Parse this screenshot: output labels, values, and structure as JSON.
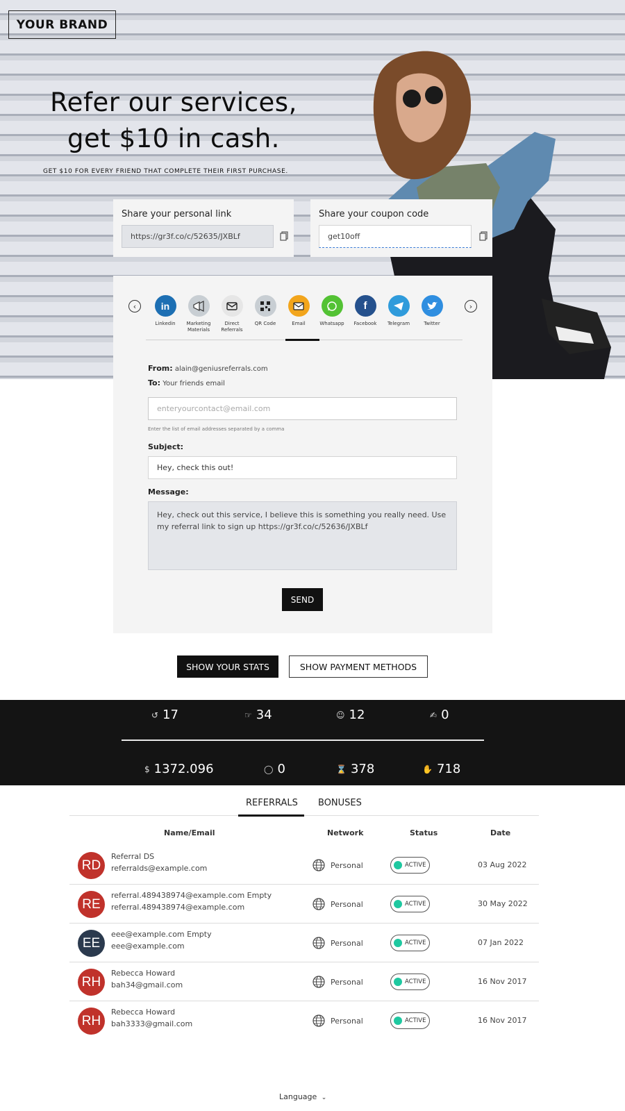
{
  "brand": "YOUR BRAND",
  "hero": {
    "headline_line1": "Refer our services,",
    "headline_line2": "get $10 in cash.",
    "subline": "GET $10 FOR EVERY FRIEND THAT COMPLETE THEIR FIRST PURCHASE."
  },
  "share_link": {
    "label": "Share your personal link",
    "value": "https://gr3f.co/c/52635/JXBLf"
  },
  "share_coupon": {
    "label": "Share your coupon code",
    "value": "get10off"
  },
  "channels": [
    {
      "label": "Linkedin",
      "icon": "linkedin-icon",
      "color": "#1d6fb3"
    },
    {
      "label": "Marketing Materials",
      "icon": "megaphone-icon",
      "color": "#c8ced3"
    },
    {
      "label": "Direct Referrals",
      "icon": "envelope-outline-icon",
      "color": "#e6e6e6"
    },
    {
      "label": "QR Code",
      "icon": "qr-code-icon",
      "color": "#c8ced3"
    },
    {
      "label": "Email",
      "icon": "email-icon",
      "color": "#f2a51c"
    },
    {
      "label": "Whatsapp",
      "icon": "whatsapp-icon",
      "color": "#53c234"
    },
    {
      "label": "Facebook",
      "icon": "facebook-icon",
      "color": "#25518d"
    },
    {
      "label": "Telegram",
      "icon": "telegram-icon",
      "color": "#2f9bdb"
    },
    {
      "label": "Twitter",
      "icon": "twitter-icon",
      "color": "#2f8ee0"
    }
  ],
  "email_form": {
    "from_label": "From:",
    "from_value": "alain@geniusreferrals.com",
    "to_label": "To:",
    "to_value": "Your friends email",
    "contacts_placeholder": "enteryourcontact@email.com",
    "helper": "Enter the list of email addresses separated by a comma",
    "subject_label": "Subject:",
    "subject_value": "Hey, check this out!",
    "message_label": "Message:",
    "message_value": "Hey, check out this service, I believe this is something you really need. Use my referral link to sign up https://gr3f.co/c/52636/JXBLf",
    "send_label": "SEND"
  },
  "buttons": {
    "stats": "SHOW YOUR STATS",
    "payment": "SHOW PAYMENT METHODS"
  },
  "stats": {
    "top": [
      "17",
      "34",
      "12",
      "0"
    ],
    "bottom": [
      "1372.096",
      "0",
      "378",
      "718"
    ]
  },
  "tabs": {
    "referrals": "REFERRALS",
    "bonuses": "BONUSES"
  },
  "table": {
    "headers": {
      "name": "Name/Email",
      "network": "Network",
      "status": "Status",
      "date": "Date"
    },
    "rows": [
      {
        "initials": "RD",
        "avatar_color": "#c0322b",
        "name": "Referral DS",
        "email": "referralds@example.com",
        "network": "Personal",
        "status": "ACTIVE",
        "date": "03 Aug 2022"
      },
      {
        "initials": "RE",
        "avatar_color": "#c0322b",
        "name": "referral.489438974@example.com Empty",
        "email": "referral.489438974@example.com",
        "network": "Personal",
        "status": "ACTIVE",
        "date": "30 May 2022"
      },
      {
        "initials": "EE",
        "avatar_color": "#2b3a4e",
        "name": "eee@example.com Empty",
        "email": "eee@example.com",
        "network": "Personal",
        "status": "ACTIVE",
        "date": "07 Jan 2022"
      },
      {
        "initials": "RH",
        "avatar_color": "#c0322b",
        "name": "Rebecca Howard",
        "email": "bah34@gmail.com",
        "network": "Personal",
        "status": "ACTIVE",
        "date": "16 Nov 2017"
      },
      {
        "initials": "RH",
        "avatar_color": "#c0322b",
        "name": "Rebecca Howard",
        "email": "bah3333@gmail.com",
        "network": "Personal",
        "status": "ACTIVE",
        "date": "16 Nov 2017"
      }
    ]
  },
  "footer": {
    "language": "Language"
  }
}
